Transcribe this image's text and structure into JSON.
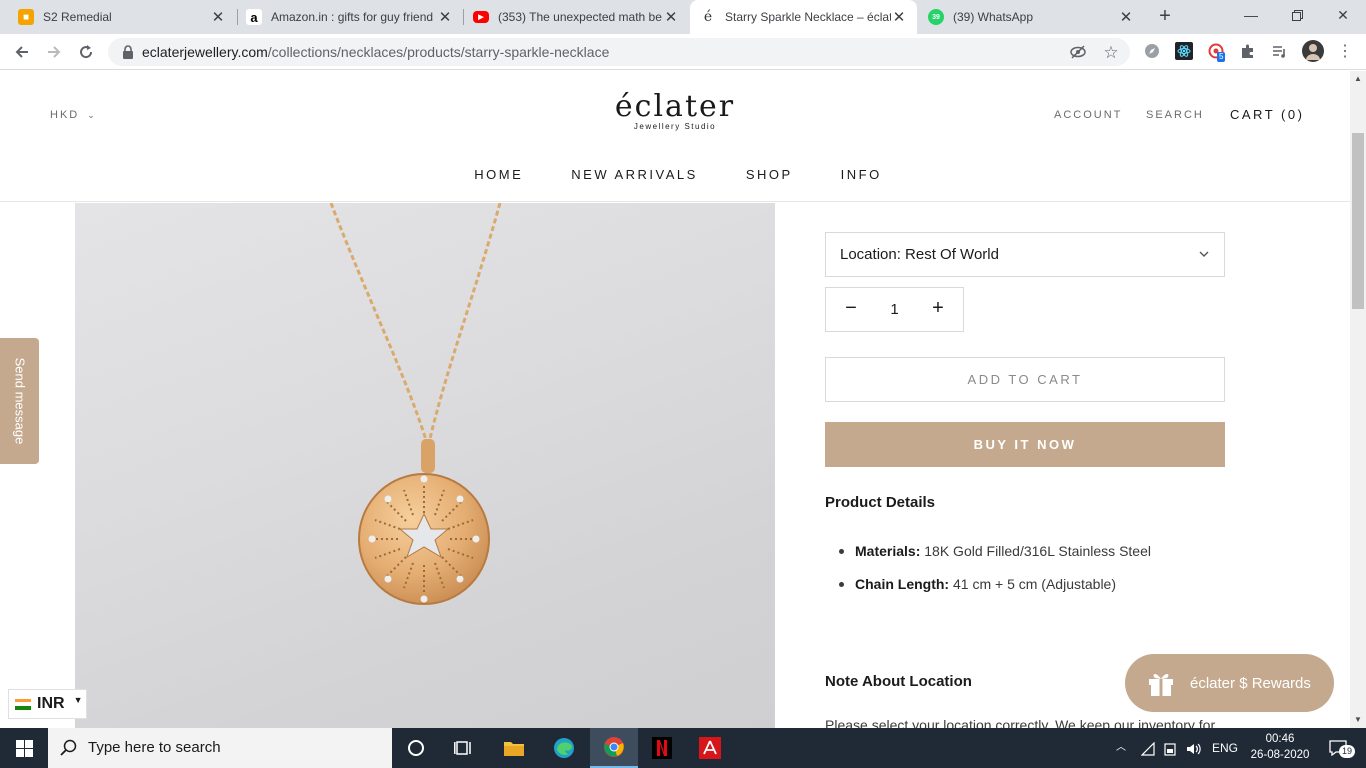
{
  "browser": {
    "tabs": [
      {
        "title": "S2 Remedial",
        "favicon": "classroom-icon",
        "color": "#f4a300"
      },
      {
        "title": "Amazon.in : gifts for guy friend",
        "favicon": "amazon-icon",
        "color": "#ffffff"
      },
      {
        "title": "(353) The unexpected math be",
        "favicon": "youtube-icon",
        "color": "#ff0000"
      },
      {
        "title": "Starry Sparkle Necklace – éclat",
        "favicon": "eclater-icon",
        "color": "#ffffff"
      },
      {
        "title": "(39) WhatsApp",
        "favicon": "whatsapp-icon",
        "color": "#25d366"
      }
    ],
    "active_tab_index": 3,
    "address": {
      "domain": "eclaterjewellery.com",
      "path": "/collections/necklaces/products/starry-sparkle-necklace"
    },
    "extension_badge": "5"
  },
  "site": {
    "currency": "HKD",
    "logo": {
      "name": "éclater",
      "subtitle": "Jewellery Studio"
    },
    "header_links": {
      "account": "ACCOUNT",
      "search": "SEARCH",
      "cart": "CART (0)"
    },
    "nav": [
      "HOME",
      "NEW ARRIVALS",
      "SHOP",
      "INFO"
    ]
  },
  "product": {
    "location_label": "Location: Rest Of World",
    "quantity": "1",
    "add_to_cart": "ADD TO CART",
    "buy_now": "BUY IT NOW",
    "details_heading": "Product Details",
    "details": [
      {
        "label": "Materials:",
        "value": "18K Gold Filled/316L Stainless Steel"
      },
      {
        "label": "Chain Length:",
        "value": "41 cm + 5 cm (Adjustable)"
      }
    ],
    "note_heading": "Note About Location",
    "note_text": "Please select your location correctly. We keep our inventory for"
  },
  "widgets": {
    "send_message": "Send message",
    "rewards": "éclater $ Rewards",
    "currency_switch": "INR"
  },
  "taskbar": {
    "search_placeholder": "Type here to search",
    "language": "ENG",
    "time": "00:46",
    "date": "26-08-2020",
    "notifications": "19"
  },
  "colors": {
    "accent": "#c4a98e",
    "taskbar": "#1f2a36"
  }
}
